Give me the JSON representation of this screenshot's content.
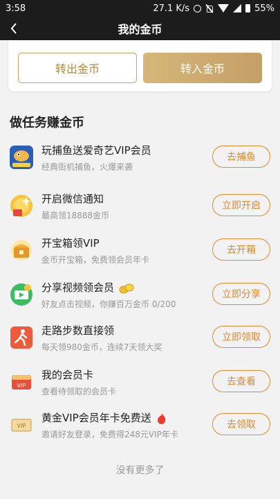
{
  "status_bar": {
    "time": "3:58",
    "network_speed": "27.1 K/s",
    "battery": "55%"
  },
  "header": {
    "title": "我的金币",
    "back_icon": "chevron-left-icon"
  },
  "coins": {
    "transfer_out_label": "转出金币",
    "transfer_in_label": "转入金币"
  },
  "tasks_section": {
    "title": "做任务赚金币",
    "tasks": [
      {
        "title": "玩捕鱼送爱奇艺VIP会员",
        "desc": "经典街机捕鱼，火爆来袭",
        "action": "去捕鱼",
        "icon": "fish-game-icon"
      },
      {
        "title": "开启微信通知",
        "desc": "最高领18888金币",
        "action": "立即开启",
        "icon": "coin-gift-icon"
      },
      {
        "title": "开宝箱领VIP",
        "desc": "金币开宝箱，免费领会员年卡",
        "action": "去开箱",
        "icon": "treasure-box-icon"
      },
      {
        "title": "分享视频领会员",
        "desc": "好友点击视频，你赚百万金币 0/200",
        "action": "立即分享",
        "icon": "share-video-icon",
        "badge_icon": "gold-coins-icon"
      },
      {
        "title": "走路步数直接领",
        "desc": "每天领980金币，连续7天领大奖",
        "action": "立即领取",
        "icon": "walking-icon"
      },
      {
        "title": "我的会员卡",
        "desc": "查看待领取的会员卡",
        "action": "去查看",
        "icon": "vip-card-icon"
      },
      {
        "title": "黄金VIP会员年卡免费送",
        "desc": "邀请好友登录，免费得248元VIP年卡",
        "action": "去领取",
        "icon": "vip-ticket-icon",
        "badge_icon": "fire-icon"
      }
    ]
  },
  "footer": {
    "text": "没有更多了"
  },
  "colors": {
    "accent": "#e28a2e",
    "gold": "#c9a461",
    "header_bg": "#1c1c1c"
  }
}
